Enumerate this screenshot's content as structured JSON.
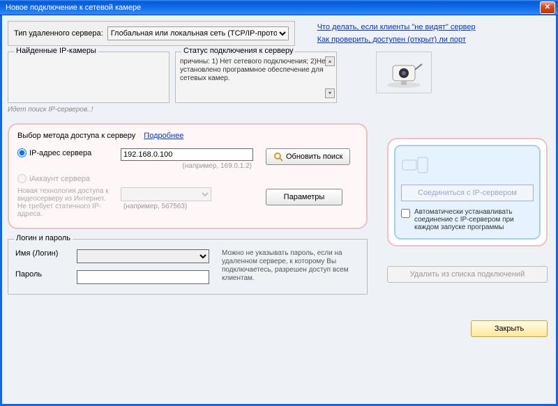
{
  "title": "Новое подключение к сетевой камере",
  "server_type": {
    "label": "Тип удаленного сервера:",
    "selected": "Глобальная или локальная сеть (TCP/IP-протокол)"
  },
  "links": {
    "no_see": "Что делать, если клиенты \"не видят\" сервер",
    "check_port": "Как проверить, доступен (открыт) ли порт"
  },
  "found": {
    "title": "Найденные IP-камеры"
  },
  "status": {
    "title": "Статус подключения к серверу",
    "body": "причины: 1) Нет сетевого подключения; 2)Не установлено программное обеспечение для сетевых камер."
  },
  "searching_note": "Идет поиск IP-серверов..!",
  "method": {
    "title": "Выбор метода доступа к серверу",
    "details": "Подробнее",
    "radio_ip": "IP-адрес сервера",
    "ip_value": "192.168.0.100",
    "ip_hint": "(например, 169.0.1.2)",
    "radio_account": "iАккаунт сервера",
    "account_note": "Новая технология доступа к видеосерверу из Интернет. Не требует статичного IP-адреса.",
    "account_hint": "(например, 567563)",
    "refresh_btn": "Обновить поиск",
    "params_btn": "Параметры"
  },
  "login": {
    "legend": "Логин и пароль",
    "name_label": "Имя (Логин)",
    "pass_label": "Пароль",
    "hint": "Можно не указывать пароль, если на удаленном сервере, к которому Вы подключаетесь, разрешен доступ всем клиентам."
  },
  "right": {
    "connect_btn": "Соединиться с IP-сервером",
    "auto_label": "Автоматически устанавливать соединение с IP-сервером при каждом запуске программы",
    "delete_btn": "Удалить из списка подключений",
    "close_btn": "Закрыть"
  }
}
